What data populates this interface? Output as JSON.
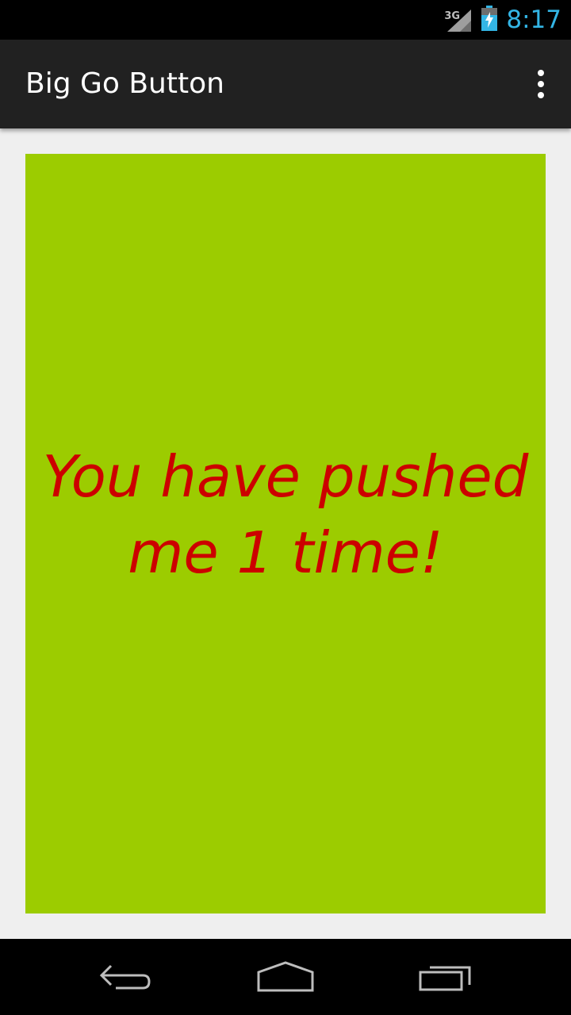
{
  "status_bar": {
    "network": "3G",
    "time": "8:17",
    "icons": [
      "signal-icon",
      "battery-charging-icon"
    ],
    "clock_color": "#33b5e5"
  },
  "action_bar": {
    "title": "Big Go Button",
    "overflow_icon": "overflow-menu-icon"
  },
  "main": {
    "button_text_line1": "You have pushed",
    "button_text_line2": "me 1 time!",
    "button_color": "#9ccc00",
    "text_color": "#cc0000"
  },
  "nav_bar": {
    "icons": [
      "back-icon",
      "home-icon",
      "recents-icon"
    ]
  }
}
